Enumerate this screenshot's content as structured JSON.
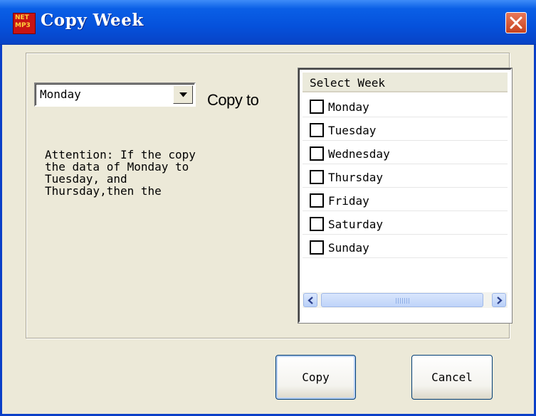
{
  "window": {
    "title": "Copy Week",
    "app_icon_lines": [
      "NET",
      "MP3"
    ],
    "close_icon": "close-icon"
  },
  "day_select": {
    "selected": "Monday",
    "arrow_icon": "chevron-down-icon"
  },
  "copy_to_label": "Copy to",
  "attention_text": "Attention: If the copy\nthe data of Monday to\nTuesday, and\nThursday,then the",
  "week_list": {
    "header": "Select Week",
    "items": [
      {
        "label": "Monday",
        "checked": false
      },
      {
        "label": "Tuesday",
        "checked": false
      },
      {
        "label": "Wednesday",
        "checked": false
      },
      {
        "label": "Thursday",
        "checked": false
      },
      {
        "label": "Friday",
        "checked": false
      },
      {
        "label": "Saturday",
        "checked": false
      },
      {
        "label": "Sunday",
        "checked": false
      }
    ]
  },
  "buttons": {
    "copy": "Copy",
    "cancel": "Cancel"
  },
  "colors": {
    "titlebar": "#0551DB",
    "dialog_bg": "#ECE9D8",
    "close_button": "#D6512E"
  }
}
